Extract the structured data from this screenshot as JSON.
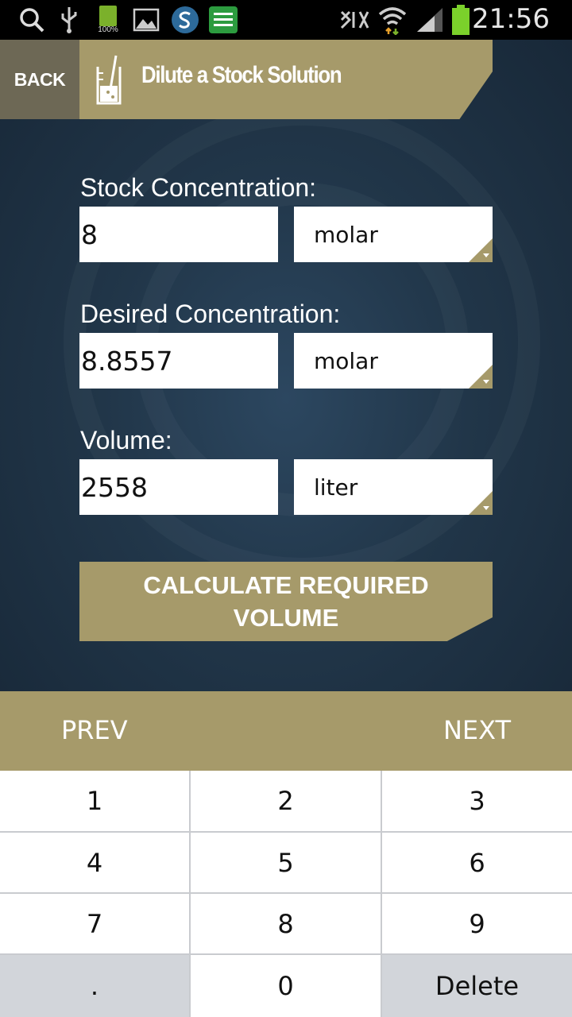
{
  "status_bar": {
    "time": "21:56",
    "battery_label": "100%",
    "icons": [
      "search-icon",
      "usb-icon",
      "battery-full-icon",
      "gallery-icon",
      "app-s-icon",
      "app-green-icon",
      "signal-mute-icon",
      "wifi-icon",
      "cellular-icon",
      "battery-icon"
    ]
  },
  "header": {
    "back_label": "BACK",
    "title": "Dilute a Stock Solution"
  },
  "form": {
    "stock": {
      "label": "Stock Concentration:",
      "value": "8",
      "unit": "molar"
    },
    "desired": {
      "label": "Desired Concentration:",
      "value": "8.8557",
      "unit": "molar"
    },
    "volume": {
      "label": "Volume:",
      "value": "2558",
      "unit": "liter"
    },
    "calculate_label": "CALCULATE REQUIRED VOLUME"
  },
  "nav": {
    "prev": "PREV",
    "next": "NEXT"
  },
  "keypad": {
    "keys": [
      "1",
      "2",
      "3",
      "4",
      "5",
      "6",
      "7",
      "8",
      "9",
      ".",
      "0",
      "Delete"
    ]
  },
  "colors": {
    "accent": "#a69a6a",
    "back_button": "#6d6855",
    "background": "#1d2c3c"
  }
}
